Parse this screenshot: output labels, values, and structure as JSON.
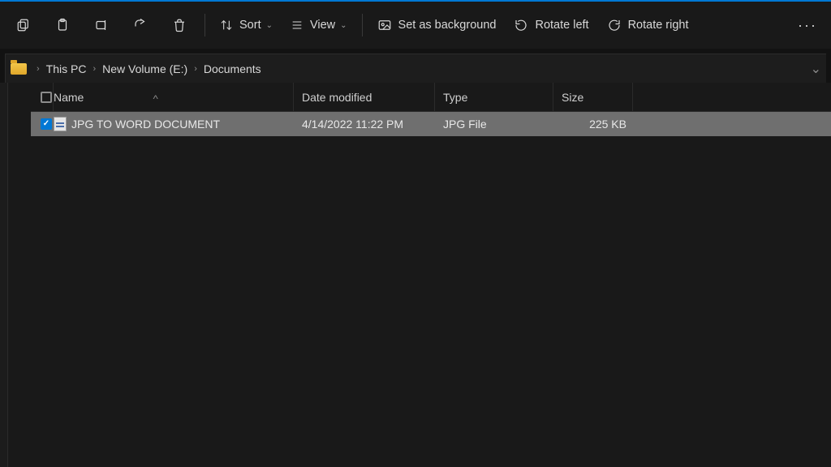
{
  "toolbar": {
    "sort_label": "Sort",
    "view_label": "View",
    "set_bg_label": "Set as background",
    "rotate_left_label": "Rotate left",
    "rotate_right_label": "Rotate right"
  },
  "breadcrumb": {
    "segments": [
      "This PC",
      "New Volume (E:)",
      "Documents"
    ]
  },
  "columns": {
    "name": "Name",
    "date": "Date modified",
    "type": "Type",
    "size": "Size"
  },
  "files": [
    {
      "selected": true,
      "name": "JPG TO WORD DOCUMENT",
      "date": "4/14/2022 11:22 PM",
      "type": "JPG File",
      "size": "225 KB"
    }
  ]
}
